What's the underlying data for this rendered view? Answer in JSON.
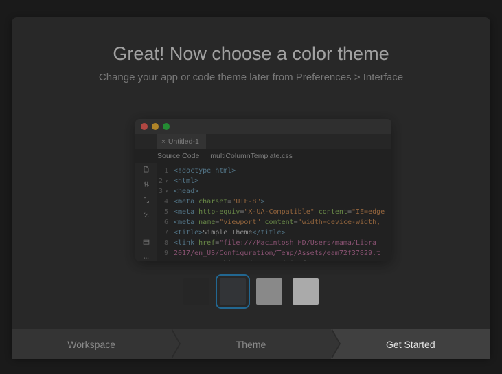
{
  "heading": "Great! Now choose a color theme",
  "subheading": "Change your app or code theme later from Preferences > Interface",
  "editor": {
    "tab_label": "Untitled-1",
    "subtabs": [
      "Source Code",
      "multiColumnTemplate.css"
    ]
  },
  "swatches": [
    {
      "name": "dark",
      "hex": "#2c2c2c",
      "selected": false
    },
    {
      "name": "medium-dark",
      "hex": "#3e4145",
      "selected": true
    },
    {
      "name": "light-grey",
      "hex": "#c3c3c3",
      "selected": false
    },
    {
      "name": "white",
      "hex": "#f6f6f6",
      "selected": false
    }
  ],
  "steps": [
    {
      "label": "Workspace",
      "active": false
    },
    {
      "label": "Theme",
      "active": false
    },
    {
      "label": "Get Started",
      "active": true
    }
  ]
}
